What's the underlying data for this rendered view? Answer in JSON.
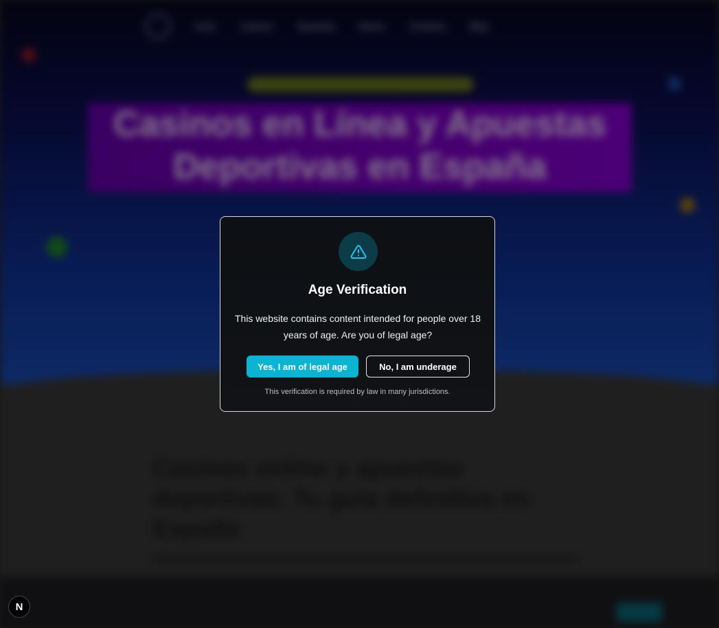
{
  "background": {
    "nav_items": [
      "Inicio",
      "Casinos",
      "Apuestas",
      "Bonos",
      "Contacto",
      "Blog"
    ],
    "hero_title": "Casinos en Línea y Apuestas Deportivas en España",
    "content_title": "Casinos online y apuestas deportivas: Tu guía definitiva en España"
  },
  "modal": {
    "icon": "alert-triangle-icon",
    "title": "Age Verification",
    "body": "This website contains content intended for people over 18 years of age. Are you of legal age?",
    "confirm_label": "Yes, I am of legal age",
    "deny_label": "No, I am underage",
    "note": "This verification is required by law in many jurisdictions."
  },
  "dev_indicator": {
    "label": "N"
  },
  "colors": {
    "accent": "#0cb4d4",
    "modal_bg": "#0f1215",
    "icon_circle": "#0c3c48"
  }
}
